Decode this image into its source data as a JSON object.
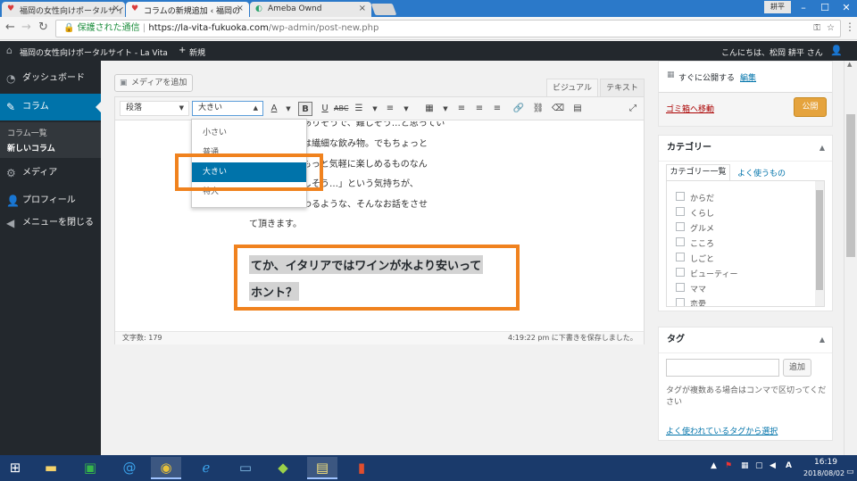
{
  "browser": {
    "tabs": [
      {
        "title": "福岡の女性向けポータルサイ",
        "close": "×"
      },
      {
        "title": "コラムの新規追加 ‹ 福岡の",
        "close": "×"
      },
      {
        "title": "Ameba Ownd",
        "close": "×"
      }
    ],
    "window_user": "耕平",
    "url_secure": "保護された通信",
    "url_host": "https://la-vita-fukuoka.com",
    "url_path": "/wp-admin/post-new.php"
  },
  "adminbar": {
    "site_name": "福岡の女性向けポータルサイト - La Vita",
    "new_label": "新規",
    "greeting": "こんにちは、松岡 耕平 さん"
  },
  "sidebar": {
    "items": [
      {
        "label": "ダッシュボード",
        "icon": "dashboard-icon"
      },
      {
        "label": "コラム",
        "icon": "pin-icon"
      },
      {
        "label": "メディア",
        "icon": "media-icon"
      },
      {
        "label": "プロフィール",
        "icon": "user-icon"
      },
      {
        "label": "メニューを閉じる",
        "icon": "collapse-icon"
      }
    ],
    "submenu": [
      "コラム一覧",
      "新しいコラム"
    ]
  },
  "editor": {
    "add_media": "メディアを追加",
    "tab_visual": "ビジュアル",
    "tab_text": "テキスト",
    "format_select": "段落",
    "size_select": "大きい",
    "size_options": [
      "小さい",
      "普通",
      "大きい",
      "特大"
    ],
    "paragraph_lines": [
      "れ、…。とかありそうで、難しそう…と思ってい",
      "確かにワインは繊細な飲み物。でもちょっと",
      "だけで今よりもっと気軽に楽しめるものなん",
      "回はその「難しそう…」という気持ちが、",
      "たい！」に変わるような、そんなお話をさせ",
      "て頂きます。"
    ],
    "heading_lines": [
      "てか、イタリアではワインが水より安いって",
      "ホント？"
    ],
    "word_count": "文字数: 179",
    "save_status": "4:19:22 pm に下書きを保存しました。"
  },
  "publish": {
    "publish_now": "すぐに公開する",
    "edit_link": "編集",
    "trash": "ゴミ箱へ移動",
    "publish_button": "公開"
  },
  "categories": {
    "title": "カテゴリー",
    "tab_all": "カテゴリー一覧",
    "tab_popular": "よく使うもの",
    "items": [
      "からだ",
      "くらし",
      "グルメ",
      "こころ",
      "しごと",
      "ビューティー",
      "ママ",
      "恋愛"
    ]
  },
  "tags": {
    "title": "タグ",
    "add_button": "追加",
    "help": "タグが複数ある場合はコンマで区切ってください",
    "popular_link": "よく使われているタグから選択"
  },
  "taskbar": {
    "time": "16:19",
    "date": "2018/08/02"
  },
  "colors": {
    "accent": "#0073aa",
    "highlight_box": "#f0821e",
    "publish_button": "#e5a33d"
  }
}
